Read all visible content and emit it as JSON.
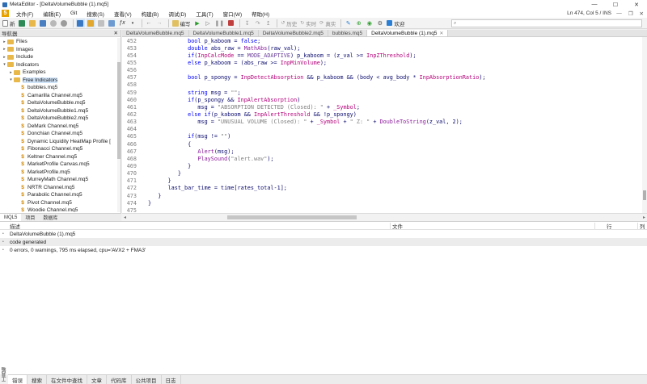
{
  "window": {
    "title": "MetaEditor - [DeltaVolumeBubble (1).mq5]",
    "min": "—",
    "max": "☐",
    "close": "✕"
  },
  "menu": {
    "logo": "5",
    "items": [
      "文件(F)",
      "编辑(E)",
      "Git",
      "搜索(S)",
      "查看(V)",
      "构建(B)",
      "调试(D)",
      "工具(T)",
      "窗口(W)",
      "帮助(H)"
    ],
    "status": "Ln 474, Col 5  /  INS",
    "ctrl_min": "—",
    "ctrl_restore": "❐",
    "ctrl_close": "✕"
  },
  "toolbar": {
    "new_label": "新",
    "compile_label": "编写",
    "history_label": "历史",
    "realtime_label": "实时",
    "real_label": "真实",
    "fav_label": "欢迎",
    "search_placeholder": ""
  },
  "navigator": {
    "title": "导航器",
    "close": "✕",
    "items": [
      {
        "label": "Files",
        "type": "folder",
        "level": 0,
        "exp": "▸"
      },
      {
        "label": "Images",
        "type": "folder",
        "level": 0,
        "exp": "▸"
      },
      {
        "label": "Include",
        "type": "folder",
        "level": 0,
        "exp": "▸"
      },
      {
        "label": "Indicators",
        "type": "folder",
        "level": 0,
        "exp": "▾"
      },
      {
        "label": "Examples",
        "type": "folder",
        "level": 1,
        "exp": "▸"
      },
      {
        "label": "Free Indicators",
        "type": "folder",
        "level": 1,
        "exp": "▾",
        "selected": true
      },
      {
        "label": "bubbles.mq5",
        "type": "file",
        "level": 2
      },
      {
        "label": "Camarilla Channel.mq5",
        "type": "file",
        "level": 2
      },
      {
        "label": "DeltaVolumeBubble.mq5",
        "type": "file",
        "level": 2
      },
      {
        "label": "DeltaVolumeBubble1.mq5",
        "type": "file",
        "level": 2
      },
      {
        "label": "DeltaVolumeBubble2.mq5",
        "type": "file",
        "level": 2
      },
      {
        "label": "DeMark Channel.mq5",
        "type": "file",
        "level": 2
      },
      {
        "label": "Donchian Channel.mq5",
        "type": "file",
        "level": 2
      },
      {
        "label": "Dynamic Liquidity HeatMap Profile [",
        "type": "file",
        "level": 2
      },
      {
        "label": "Fibonacci Channel.mq5",
        "type": "file",
        "level": 2
      },
      {
        "label": "Keltner Channel.mq5",
        "type": "file",
        "level": 2
      },
      {
        "label": "MarketProfile Canvas.mq5",
        "type": "file",
        "level": 2
      },
      {
        "label": "MarketProfile.mq5",
        "type": "file",
        "level": 2
      },
      {
        "label": "MurreyMath Channel.mq5",
        "type": "file",
        "level": 2
      },
      {
        "label": "NRTR Channel.mq5",
        "type": "file",
        "level": 2
      },
      {
        "label": "Parabolic Channel.mq5",
        "type": "file",
        "level": 2
      },
      {
        "label": "Pivot Channel.mq5",
        "type": "file",
        "level": 2
      },
      {
        "label": "Woodie Channel.mq5",
        "type": "file",
        "level": 2
      }
    ],
    "tabs": [
      "MQL5",
      "项目",
      "数据库"
    ]
  },
  "editor": {
    "tabs": [
      {
        "label": "DeltaVolumeBubble.mq5",
        "active": false
      },
      {
        "label": "DeltaVolumeBubble1.mq5",
        "active": false
      },
      {
        "label": "DeltaVolumeBubble2.mq5",
        "active": false
      },
      {
        "label": "bubbles.mq5",
        "active": false
      },
      {
        "label": "DeltaVolumeBubble (1).mq5",
        "active": true
      }
    ],
    "tab_close": "✕",
    "lines": [
      {
        "n": "452",
        "text": "            bool p_kaboom = false;"
      },
      {
        "n": "453",
        "text": "            double abs_raw = MathAbs(raw_val);"
      },
      {
        "n": "454",
        "text": "            if(InpCalcMode == MODE_ADAPTIVE) p_kaboom = (z_val >= InpZThreshold);"
      },
      {
        "n": "455",
        "text": "            else p_kaboom = (abs_raw >= InpMinVolume);"
      },
      {
        "n": "456",
        "text": ""
      },
      {
        "n": "457",
        "text": "            bool p_spongy = InpDetectAbsorption && p_kaboom && (body < avg_body * InpAbsorptionRatio);"
      },
      {
        "n": "458",
        "text": ""
      },
      {
        "n": "459",
        "text": "            string msg = \"\";"
      },
      {
        "n": "460",
        "text": "            if(p_spongy && InpAlertAbsorption)"
      },
      {
        "n": "461",
        "text": "               msg = \"ABSORPTION DETECTED (Closed): \" + _Symbol;"
      },
      {
        "n": "462",
        "text": "            else if(p_kaboom && InpAlertThreshold && !p_spongy)"
      },
      {
        "n": "463",
        "text": "               msg = \"UNUSUAL VOLUME (Closed): \" + _Symbol + \" Z: \" + DoubleToString(z_val, 2);"
      },
      {
        "n": "464",
        "text": ""
      },
      {
        "n": "465",
        "text": "            if(msg != \"\")"
      },
      {
        "n": "466",
        "text": "            {"
      },
      {
        "n": "467",
        "text": "               Alert(msg);"
      },
      {
        "n": "468",
        "text": "               PlaySound(\"alert.wav\");"
      },
      {
        "n": "469",
        "text": "            }"
      },
      {
        "n": "470",
        "text": "         }"
      },
      {
        "n": "471",
        "text": "      }"
      },
      {
        "n": "472",
        "text": "      last_bar_time = time[rates_total-1];"
      },
      {
        "n": "473",
        "text": "   }"
      },
      {
        "n": "474",
        "text": "}"
      },
      {
        "n": "475",
        "text": ""
      }
    ]
  },
  "toolbox": {
    "headers": {
      "desc": "描述",
      "file": "文件",
      "line": "行",
      "col": "列"
    },
    "messages": [
      {
        "text": "DeltaVolumeBubble (1).mq5",
        "shaded": false
      },
      {
        "text": "code generated",
        "shaded": true
      },
      {
        "text": "0 errors, 0 warnings, 795 ms elapsed, cpu='AVX2 + FMA3'",
        "shaded": false
      }
    ],
    "side_label": "工具箱",
    "tabs": [
      "错误",
      "搜索",
      "在文件中查找",
      "文章",
      "代码库",
      "公共项目",
      "日志"
    ]
  },
  "colors": {
    "keyword": "#0000ff",
    "type": "#0000ff",
    "string": "#808080",
    "macro": "#b5007a",
    "function": "#8b1a9c",
    "constant": "#6a3d9a",
    "plain": "#0a0a6e"
  }
}
